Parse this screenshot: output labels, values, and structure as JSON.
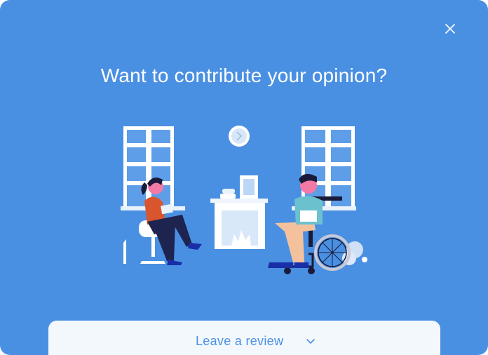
{
  "modal": {
    "title": "Want to contribute your opinion?",
    "close_icon": "close-icon",
    "review_label": "Leave a review",
    "review_icon": "chevron-down-icon"
  },
  "colors": {
    "background": "#4a90e2",
    "review_bar": "#f3f8fd",
    "accent": "#4a90e2",
    "text_light": "#ffffff"
  }
}
